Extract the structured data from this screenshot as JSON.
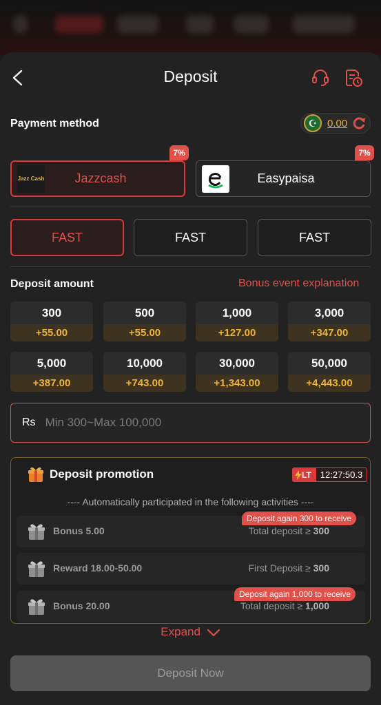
{
  "header": {
    "title": "Deposit"
  },
  "payment": {
    "label": "Payment method",
    "balance": "0.00",
    "methods": [
      {
        "name": "Jazzcash",
        "badge": "7%",
        "logo_text": "Jazz Cash"
      },
      {
        "name": "Easypaisa",
        "badge": "7%",
        "logo_text": "e"
      }
    ],
    "channels": [
      "FAST",
      "FAST",
      "FAST"
    ]
  },
  "amount": {
    "label": "Deposit amount",
    "bonus_link": "Bonus event explanation",
    "options": [
      {
        "value": "300",
        "bonus": "+55.00"
      },
      {
        "value": "500",
        "bonus": "+55.00"
      },
      {
        "value": "1,000",
        "bonus": "+127.00"
      },
      {
        "value": "3,000",
        "bonus": "+347.00"
      },
      {
        "value": "5,000",
        "bonus": "+387.00"
      },
      {
        "value": "10,000",
        "bonus": "+743.00"
      },
      {
        "value": "30,000",
        "bonus": "+1,343.00"
      },
      {
        "value": "50,000",
        "bonus": "+4,443.00"
      }
    ],
    "currency": "Rs",
    "placeholder": "Min 300~Max 100,000"
  },
  "promotion": {
    "title": "Deposit promotion",
    "lt_label": "LT",
    "timer": "12:27:50.3",
    "subtitle": "---- Automatically participated in the following activities ----",
    "items": [
      {
        "name": "Bonus 5.00",
        "cond_text": "Total deposit ≥ ",
        "cond_value": "300",
        "tag": "Deposit again 300 to receive"
      },
      {
        "name": "Reward 18.00-50.00",
        "cond_text": "First Deposit ≥ ",
        "cond_value": "300",
        "tag": ""
      },
      {
        "name": "Bonus 20.00",
        "cond_text": "Total deposit ≥ ",
        "cond_value": "1,000",
        "tag": "Deposit again 1,000 to receive"
      }
    ],
    "expand_label": "Expand"
  },
  "actions": {
    "deposit_now": "Deposit Now"
  },
  "colors": {
    "accent": "#e2504a",
    "gold": "#f0b33a",
    "background": "#222222"
  }
}
